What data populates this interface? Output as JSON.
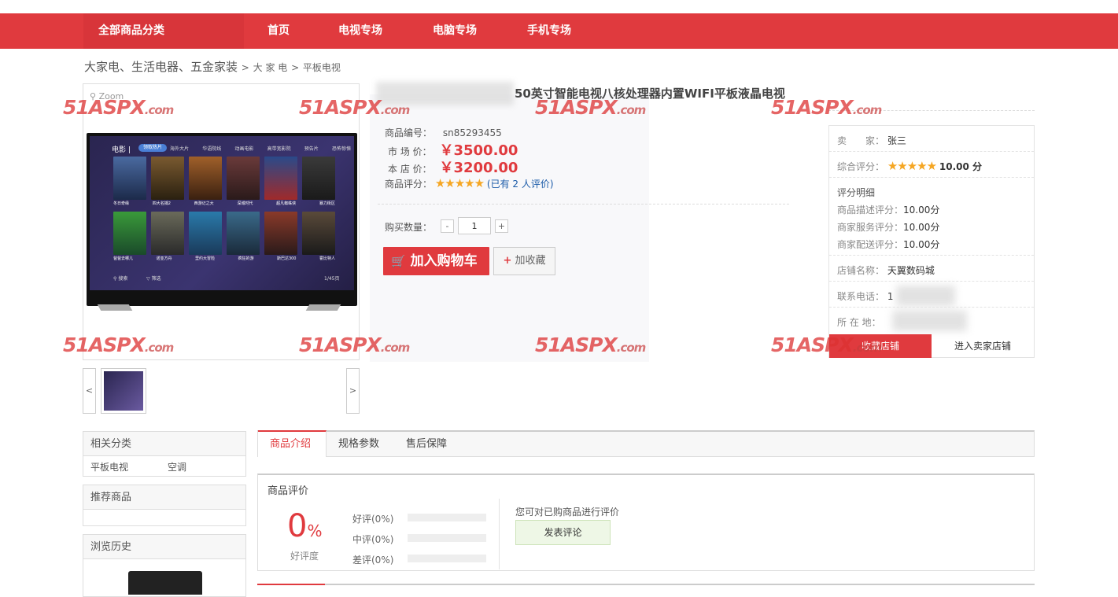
{
  "nav": {
    "all_categories": "全部商品分类",
    "items": [
      "首页",
      "电视专场",
      "电脑专场",
      "手机专场"
    ]
  },
  "breadcrumb": {
    "root": "大家电、生活电器、五金家装",
    "sep": ">",
    "level2": "大 家 电",
    "level3": "平板电视"
  },
  "gallery": {
    "zoom": "Zoom",
    "prev": "<",
    "next": ">"
  },
  "product": {
    "title": "50英寸智能电视八核处理器内置WIFI平板液晶电视",
    "code_label": "商品编号：",
    "code": "sn85293455",
    "market_price_label": "市 场 价：",
    "market_price": "￥3500.00",
    "store_price_label": "本 店 价：",
    "store_price": "￥3200.00",
    "rating_label": "商品评分：",
    "rating_stars": "★★★★★",
    "rating_link": "(已有 2 人评价)",
    "qty_label": "购买数量：",
    "qty_minus": "-",
    "qty_value": "1",
    "qty_plus": "+",
    "add_to_cart": "加入购物车",
    "favorite": "加收藏"
  },
  "seller": {
    "seller_label": "卖　　家：",
    "seller_name": "张三",
    "overall_label": "综合评分：",
    "overall_stars": "★★★★★",
    "overall_score": "10.00 分",
    "detail_title": "评分明细",
    "desc_label": "商品描述评分：",
    "desc_score": "10.00分",
    "service_label": "商家服务评分：",
    "service_score": "10.00分",
    "delivery_label": "商家配送评分：",
    "delivery_score": "10.00分",
    "shop_label": "店铺名称：",
    "shop_name": "天翼数码城",
    "phone_label": "联系电话：",
    "phone_value": "1",
    "location_label": "所 在 地：",
    "collect_shop": "收藏店铺",
    "enter_shop": "进入卖家店铺"
  },
  "watermark": {
    "main": "51ASPX",
    "suffix": ".com"
  },
  "sidebar": {
    "related_title": "相关分类",
    "related_items": [
      "平板电视",
      "空调"
    ],
    "recommend_title": "推荐商品",
    "history_title": "浏览历史"
  },
  "tabs": [
    "商品介绍",
    "规格参数",
    "售后保障"
  ],
  "reviews": {
    "title": "商品评价",
    "percent": "0",
    "percent_sign": "%",
    "percent_label": "好评度",
    "good": "好评(0%)",
    "mid": "中评(0%)",
    "bad": "差评(0%)",
    "prompt": "您可对已购商品进行评价",
    "write_button": "发表评论"
  },
  "tv_ui": {
    "category": "电影 |",
    "chip": "领取热片",
    "menu": [
      "海外大片",
      "华语院线",
      "动画电影",
      "高带宽影院",
      "预告片",
      "恐怖惊悚"
    ],
    "row1": [
      "冬日奇缘",
      "四大名捕2",
      "西游记之大",
      "深城时代",
      "超凡蜘蛛侠",
      "暴力街区"
    ],
    "row2": [
      "爸爸去哪儿",
      "诺亚方舟",
      "里约大冒险",
      "疯狂的游",
      "斯巴达300",
      "霍比特人"
    ],
    "search": "搜索",
    "filter": "筛选",
    "page": "1/45页"
  },
  "colors": {
    "brand_red": "#e03a3e",
    "star": "#f5a623",
    "link": "#1a5aa8"
  }
}
